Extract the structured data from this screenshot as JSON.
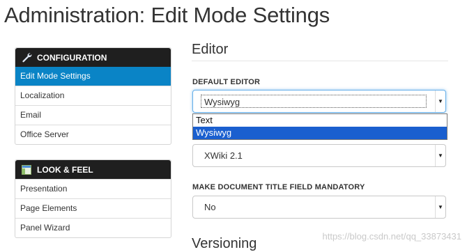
{
  "page": {
    "title": "Administration: Edit Mode Settings"
  },
  "sidebar": {
    "configuration": {
      "heading": "CONFIGURATION",
      "icon": "wrench-icon",
      "items": [
        {
          "label": "Edit Mode Settings",
          "active": true
        },
        {
          "label": "Localization"
        },
        {
          "label": "Email"
        },
        {
          "label": "Office Server"
        }
      ]
    },
    "look_and_feel": {
      "heading": "LOOK & FEEL",
      "icon": "layout-icon",
      "items": [
        {
          "label": "Presentation"
        },
        {
          "label": "Page Elements"
        },
        {
          "label": "Panel Wizard"
        }
      ]
    }
  },
  "main": {
    "editor_heading": "Editor",
    "default_editor": {
      "label": "DEFAULT EDITOR",
      "value": "Wysiwyg",
      "options": [
        "Text",
        "Wysiwyg"
      ],
      "highlighted": "Wysiwyg"
    },
    "syntax": {
      "value": "XWiki 2.1"
    },
    "mandatory_title": {
      "label": "MAKE DOCUMENT TITLE FIELD MANDATORY",
      "value": "No"
    },
    "versioning_heading": "Versioning"
  },
  "watermark": "https://blog.csdn.net/qq_33873431",
  "colors": {
    "active_item": "#0a84c6",
    "panel_header": "#1f1f1f",
    "dropdown_highlight": "#1a5fcf"
  }
}
